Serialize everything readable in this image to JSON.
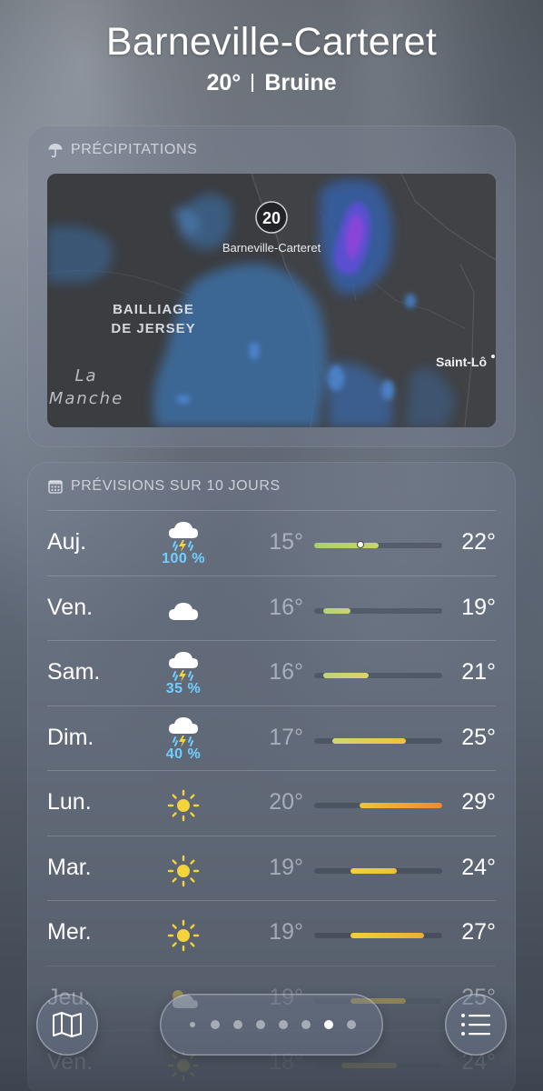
{
  "location": {
    "city": "Barneville-Carteret",
    "temperature": "20°",
    "condition": "Bruine"
  },
  "precipitation": {
    "title": "PRÉCIPITATIONS",
    "icon": "umbrella-icon",
    "map": {
      "marker_temp": "20",
      "marker_label": "Barneville-Carteret",
      "region_label_line1": "BAILLIAGE",
      "region_label_line2": "DE JERSEY",
      "sea_label_line1": "La",
      "sea_label_line2": "Manche",
      "town_label": "Saint-Lô"
    }
  },
  "forecast": {
    "title": "PRÉVISIONS SUR 10 JOURS",
    "icon": "calendar-icon",
    "range_min": 15,
    "range_max": 29,
    "days": [
      {
        "day": "Auj.",
        "icon": "cloud-lightning-rain-icon",
        "pct": "100 %",
        "low": "15°",
        "high": "22°",
        "low_val": 15,
        "high_val": 22,
        "current_val": 20,
        "color_a": "#a9cf6a",
        "color_b": "#c9d46a"
      },
      {
        "day": "Ven.",
        "icon": "cloud-icon",
        "pct": "",
        "low": "16°",
        "high": "19°",
        "low_val": 16,
        "high_val": 19,
        "color_a": "#b6d27a",
        "color_b": "#c9d27a"
      },
      {
        "day": "Sam.",
        "icon": "cloud-lightning-rain-icon",
        "pct": "35 %",
        "low": "16°",
        "high": "21°",
        "low_val": 16,
        "high_val": 21,
        "color_a": "#bfd47a",
        "color_b": "#dcd36a"
      },
      {
        "day": "Dim.",
        "icon": "cloud-lightning-rain-icon",
        "pct": "40 %",
        "low": "17°",
        "high": "25°",
        "low_val": 17,
        "high_val": 25,
        "color_a": "#cfd870",
        "color_b": "#f0c43a"
      },
      {
        "day": "Lun.",
        "icon": "sun-icon",
        "pct": "",
        "low": "20°",
        "high": "29°",
        "low_val": 20,
        "high_val": 29,
        "color_a": "#f2c23a",
        "color_b": "#ef8a32"
      },
      {
        "day": "Mar.",
        "icon": "sun-icon",
        "pct": "",
        "low": "19°",
        "high": "24°",
        "low_val": 19,
        "high_val": 24,
        "color_a": "#f2cf3a",
        "color_b": "#f1bf3a"
      },
      {
        "day": "Mer.",
        "icon": "sun-icon",
        "pct": "",
        "low": "19°",
        "high": "27°",
        "low_val": 19,
        "high_val": 27,
        "color_a": "#f2cf3a",
        "color_b": "#f0aa3a"
      },
      {
        "day": "Jeu.",
        "icon": "sun-cloud-icon",
        "pct": "",
        "low": "19°",
        "high": "25°",
        "low_val": 19,
        "high_val": 25,
        "color_a": "#f2cf3a",
        "color_b": "#f1bf3a"
      },
      {
        "day": "Ven.",
        "icon": "sun-icon",
        "pct": "",
        "low": "18°",
        "high": "24°",
        "low_val": 18,
        "high_val": 24,
        "color_a": "#f2d23a",
        "color_b": "#f1c43a"
      }
    ]
  },
  "toolbar": {
    "map_button": "map-icon",
    "list_button": "list-icon",
    "page_count": 8,
    "active_page": 7
  }
}
